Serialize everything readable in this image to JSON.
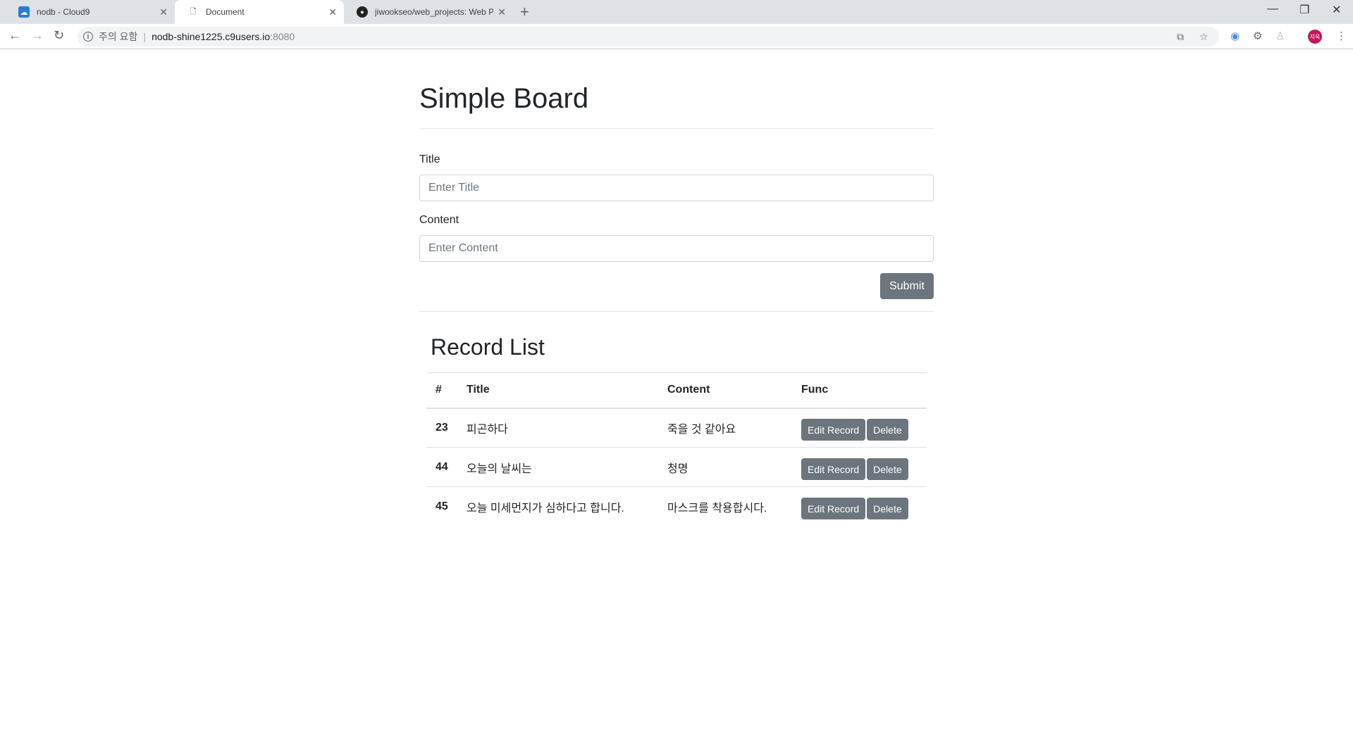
{
  "browser": {
    "tabs": [
      {
        "title": "nodb - Cloud9",
        "icon": "cloud9-icon"
      },
      {
        "title": "Document",
        "icon": "document-icon",
        "active": true
      },
      {
        "title": "jiwookseo/web_projects: Web Pr",
        "icon": "github-icon"
      }
    ],
    "url_warning": "주의 요함",
    "url_host": "nodb-shine1225.c9users.io",
    "url_port": ":8080",
    "profile_initials": "지욱"
  },
  "page": {
    "title": "Simple Board",
    "form": {
      "title_label": "Title",
      "title_placeholder": "Enter Title",
      "content_label": "Content",
      "content_placeholder": "Enter Content",
      "submit_label": "Submit"
    },
    "records": {
      "heading": "Record List",
      "columns": [
        "#",
        "Title",
        "Content",
        "Func"
      ],
      "edit_label": "Edit Record",
      "delete_label": "Delete",
      "rows": [
        {
          "id": "23",
          "title": "피곤하다",
          "content": "죽을 것 같아요"
        },
        {
          "id": "44",
          "title": "오늘의 날씨는",
          "content": "청명"
        },
        {
          "id": "45",
          "title": "오늘 미세먼지가 심하다고 합니다.",
          "content": "마스크를 착용합시다."
        }
      ]
    }
  },
  "colors": {
    "button": "#6c757d",
    "text": "#212529"
  }
}
